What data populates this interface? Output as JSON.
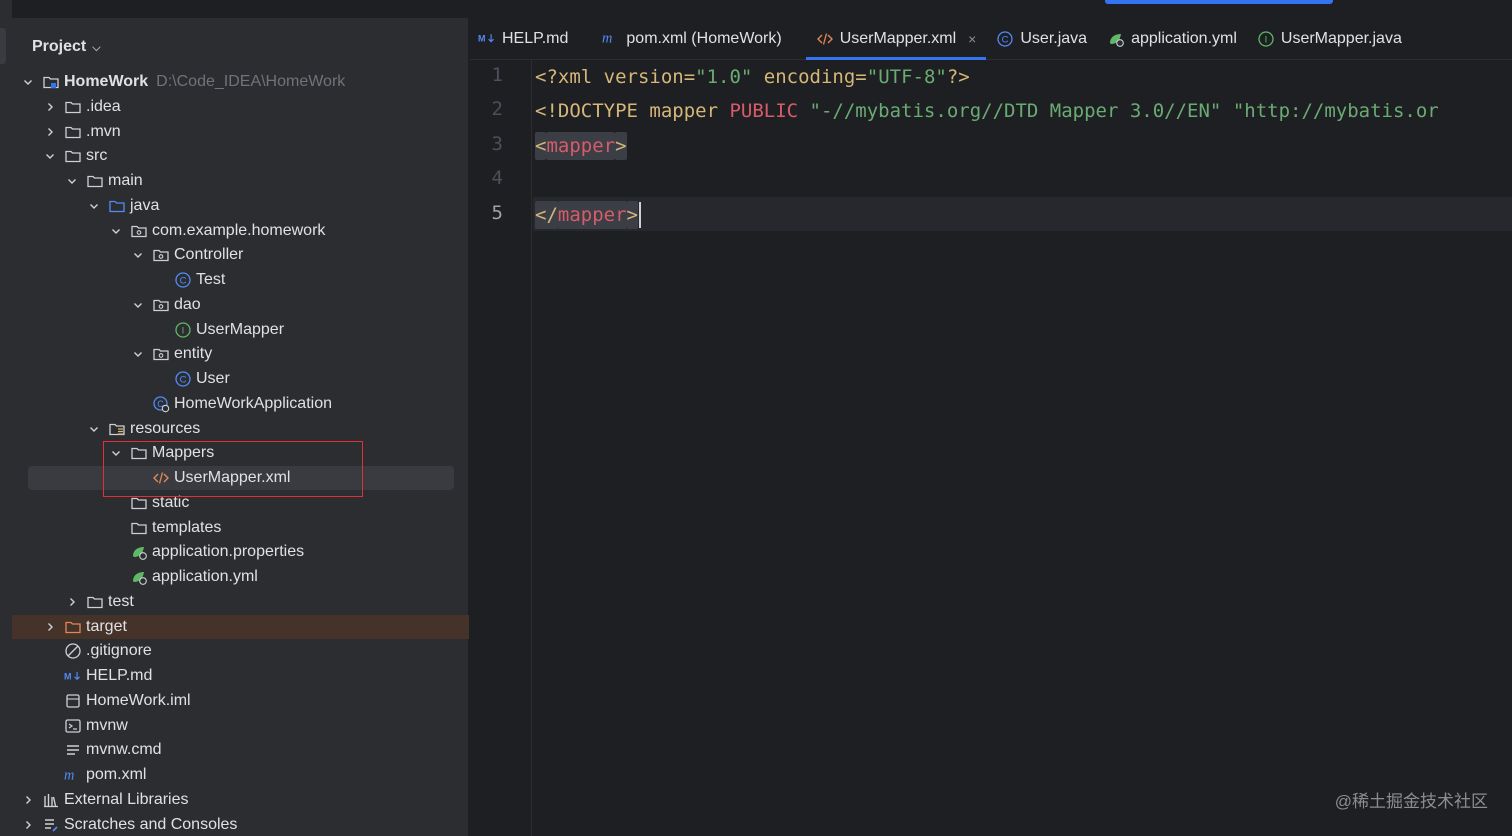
{
  "project_panel": {
    "title": "Project",
    "tree": [
      {
        "label": "HomeWork",
        "path": "D:\\Code_IDEA\\HomeWork",
        "icon": "module-folder-icon",
        "arrow": "down",
        "depth": 0
      },
      {
        "label": ".idea",
        "icon": "folder-icon",
        "arrow": "right",
        "depth": 1
      },
      {
        "label": ".mvn",
        "icon": "folder-icon",
        "arrow": "right",
        "depth": 1
      },
      {
        "label": "src",
        "icon": "folder-icon",
        "arrow": "down",
        "depth": 1
      },
      {
        "label": "main",
        "icon": "folder-icon",
        "arrow": "down",
        "depth": 2
      },
      {
        "label": "java",
        "icon": "source-folder-icon",
        "arrow": "down",
        "depth": 3
      },
      {
        "label": "com.example.homework",
        "icon": "package-icon",
        "arrow": "down",
        "depth": 4
      },
      {
        "label": "Controller",
        "icon": "package-icon",
        "arrow": "down",
        "depth": 5
      },
      {
        "label": "Test",
        "icon": "class-icon",
        "arrow": "none",
        "depth": 6
      },
      {
        "label": "dao",
        "icon": "package-icon",
        "arrow": "down",
        "depth": 5
      },
      {
        "label": "UserMapper",
        "icon": "interface-icon",
        "arrow": "none",
        "depth": 6
      },
      {
        "label": "entity",
        "icon": "package-icon",
        "arrow": "down",
        "depth": 5
      },
      {
        "label": "User",
        "icon": "class-icon",
        "arrow": "none",
        "depth": 6
      },
      {
        "label": "HomeWorkApplication",
        "icon": "spring-boot-class-icon",
        "arrow": "none",
        "depth": 5
      },
      {
        "label": "resources",
        "icon": "resources-folder-icon",
        "arrow": "down",
        "depth": 3
      },
      {
        "label": "Mappers",
        "icon": "folder-icon",
        "arrow": "down",
        "depth": 4
      },
      {
        "label": "UserMapper.xml",
        "icon": "xml-file-icon",
        "arrow": "none",
        "depth": 5,
        "selected": true
      },
      {
        "label": "static",
        "icon": "folder-icon",
        "arrow": "none",
        "depth": 4
      },
      {
        "label": "templates",
        "icon": "folder-icon",
        "arrow": "none",
        "depth": 4
      },
      {
        "label": "application.properties",
        "icon": "spring-config-icon",
        "arrow": "none",
        "depth": 4
      },
      {
        "label": "application.yml",
        "icon": "spring-config-icon",
        "arrow": "none",
        "depth": 4
      },
      {
        "label": "test",
        "icon": "folder-icon",
        "arrow": "right",
        "depth": 2
      },
      {
        "label": "target",
        "icon": "excluded-folder-icon",
        "arrow": "right",
        "depth": 1,
        "highlight": "target"
      },
      {
        "label": ".gitignore",
        "icon": "ignore-file-icon",
        "arrow": "none",
        "depth": 1
      },
      {
        "label": "HELP.md",
        "icon": "markdown-icon",
        "arrow": "none",
        "depth": 1
      },
      {
        "label": "HomeWork.iml",
        "icon": "iml-file-icon",
        "arrow": "none",
        "depth": 1
      },
      {
        "label": "mvnw",
        "icon": "shell-script-icon",
        "arrow": "none",
        "depth": 1
      },
      {
        "label": "mvnw.cmd",
        "icon": "text-file-icon",
        "arrow": "none",
        "depth": 1
      },
      {
        "label": "pom.xml",
        "icon": "maven-icon",
        "arrow": "none",
        "depth": 1
      },
      {
        "label": "External Libraries",
        "icon": "libraries-icon",
        "arrow": "right",
        "depth": 0
      },
      {
        "label": "Scratches and Consoles",
        "icon": "scratches-icon",
        "arrow": "right",
        "depth": 0
      }
    ]
  },
  "tabs": [
    {
      "label": "HELP.md",
      "icon": "markdown-icon"
    },
    {
      "label": "pom.xml (HomeWork)",
      "icon": "maven-icon"
    },
    {
      "label": "UserMapper.xml",
      "icon": "xml-file-icon",
      "active": true,
      "closable": true
    },
    {
      "label": "User.java",
      "icon": "class-icon"
    },
    {
      "label": "application.yml",
      "icon": "spring-config-icon"
    },
    {
      "label": "UserMapper.java",
      "icon": "interface-icon"
    }
  ],
  "editor": {
    "line_numbers": [
      "1",
      "2",
      "3",
      "4",
      "5"
    ],
    "current_line": "5",
    "lines": [
      [
        {
          "t": "<?xml ",
          "c": "pi"
        },
        {
          "t": "version=",
          "c": "pi"
        },
        {
          "t": "\"1.0\"",
          "c": "str"
        },
        {
          "t": " encoding=",
          "c": "pi"
        },
        {
          "t": "\"UTF-8\"",
          "c": "str"
        },
        {
          "t": "?>",
          "c": "pi"
        }
      ],
      [
        {
          "t": "<!DOCTYPE ",
          "c": "tag"
        },
        {
          "t": "mapper ",
          "c": "pi"
        },
        {
          "t": "PUBLIC ",
          "c": "red"
        },
        {
          "t": "\"-//mybatis.org//DTD Mapper 3.0//EN\"",
          "c": "str"
        },
        {
          "t": " ",
          "c": "plain"
        },
        {
          "t": "\"http://mybatis.or",
          "c": "str"
        }
      ],
      [
        {
          "t": "<",
          "c": "tag",
          "hl": true
        },
        {
          "t": "mapper",
          "c": "tagname",
          "hl": true
        },
        {
          "t": ">",
          "c": "tag",
          "hl": true
        }
      ],
      [],
      [
        {
          "t": "</",
          "c": "tag",
          "hl": true
        },
        {
          "t": "mapper",
          "c": "tagname",
          "hl": true
        },
        {
          "t": ">",
          "c": "tag",
          "hl": true
        }
      ]
    ]
  },
  "watermark": "@稀土掘金技术社区",
  "colors": {
    "accent": "#3574f0",
    "selection_box": "#e0303a"
  }
}
